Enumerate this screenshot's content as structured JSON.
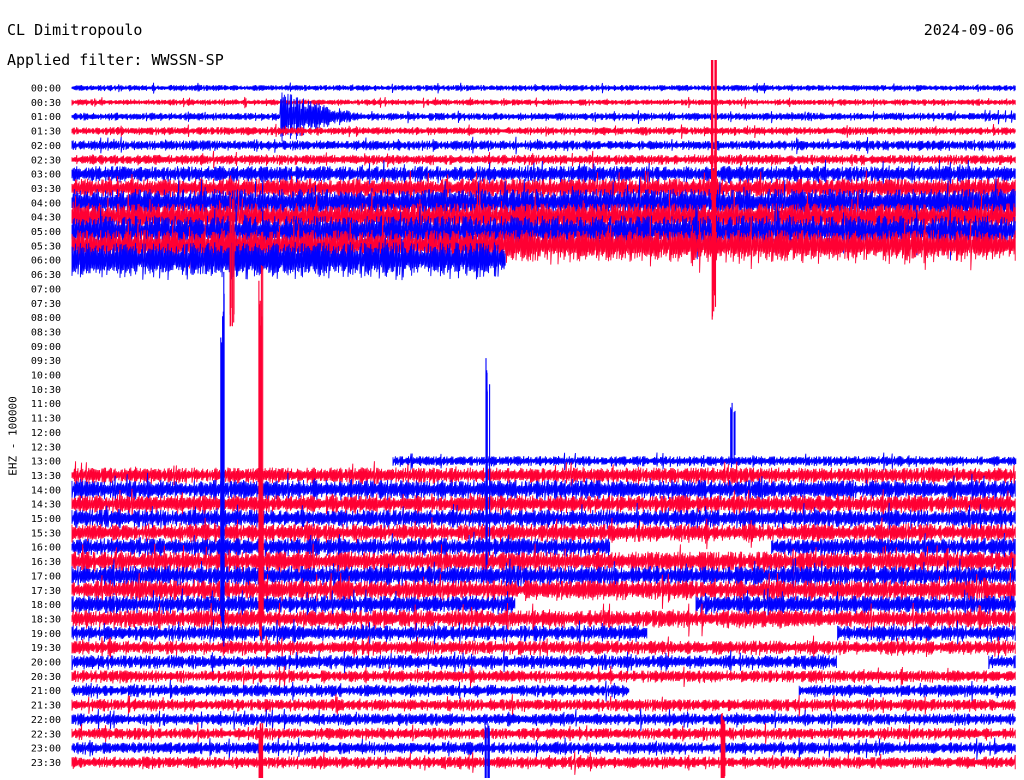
{
  "header": {
    "station": "CL Dimitropoulo",
    "date": "2024-09-06",
    "filter": "Applied filter: WWSSN-SP",
    "channel": "EHZ - 100000"
  },
  "colors": {
    "even_trace": "#0000ff",
    "odd_trace": "#ff0033",
    "background": "#ffffff"
  },
  "chart_data": {
    "type": "line",
    "title": "CL Dimitropoulo",
    "ylabel": "EHZ - 100000",
    "x_range_minutes": [
      0,
      30
    ],
    "row_labels": [
      "00:00",
      "00:30",
      "01:00",
      "01:30",
      "02:00",
      "02:30",
      "03:00",
      "03:30",
      "04:00",
      "04:30",
      "05:00",
      "05:30",
      "06:00",
      "06:30",
      "07:00",
      "07:30",
      "08:00",
      "08:30",
      "09:00",
      "09:30",
      "10:00",
      "10:30",
      "11:00",
      "11:30",
      "12:00",
      "12:30",
      "13:00",
      "13:30",
      "14:00",
      "14:30",
      "15:00",
      "15:30",
      "16:00",
      "16:30",
      "17:00",
      "17:30",
      "18:00",
      "18:30",
      "19:00",
      "19:30",
      "20:00",
      "20:30",
      "21:00",
      "21:30",
      "22:00",
      "22:30",
      "23:00",
      "23:30"
    ],
    "rows": [
      {
        "label": "00:00",
        "noise": 3,
        "start": 0,
        "end": 1
      },
      {
        "label": "00:30",
        "noise": 3,
        "start": 0,
        "end": 1
      },
      {
        "label": "01:00",
        "noise": 4,
        "start": 0,
        "end": 1,
        "bursts": [
          {
            "at": 0.22,
            "width": 0.08,
            "amp": 22
          }
        ]
      },
      {
        "label": "01:30",
        "noise": 4,
        "start": 0,
        "end": 1
      },
      {
        "label": "02:00",
        "noise": 5,
        "start": 0,
        "end": 1
      },
      {
        "label": "02:30",
        "noise": 5,
        "start": 0,
        "end": 1
      },
      {
        "label": "03:00",
        "noise": 8,
        "start": 0,
        "end": 1
      },
      {
        "label": "03:30",
        "noise": 10,
        "start": 0,
        "end": 1
      },
      {
        "label": "04:00",
        "noise": 14,
        "start": 0,
        "end": 1
      },
      {
        "label": "04:30",
        "noise": 14,
        "start": 0,
        "end": 1
      },
      {
        "label": "05:00",
        "noise": 16,
        "start": 0,
        "end": 1
      },
      {
        "label": "05:30",
        "noise": 16,
        "start": 0,
        "end": 1
      },
      {
        "label": "06:00",
        "noise": 18,
        "start": 0,
        "end": 0.46
      },
      {
        "label": "06:30",
        "noise": 0,
        "start": 0,
        "end": 0
      },
      {
        "label": "07:00",
        "noise": 0,
        "start": 0,
        "end": 0
      },
      {
        "label": "07:30",
        "noise": 0,
        "start": 0,
        "end": 0
      },
      {
        "label": "08:00",
        "noise": 0,
        "start": 0,
        "end": 0
      },
      {
        "label": "08:30",
        "noise": 0,
        "start": 0,
        "end": 0
      },
      {
        "label": "09:00",
        "noise": 0,
        "start": 0,
        "end": 0
      },
      {
        "label": "09:30",
        "noise": 0,
        "start": 0,
        "end": 0
      },
      {
        "label": "10:00",
        "noise": 0,
        "start": 0,
        "end": 0
      },
      {
        "label": "10:30",
        "noise": 0,
        "start": 0,
        "end": 0
      },
      {
        "label": "11:00",
        "noise": 0,
        "start": 0,
        "end": 0
      },
      {
        "label": "11:30",
        "noise": 0,
        "start": 0,
        "end": 0
      },
      {
        "label": "12:00",
        "noise": 0,
        "start": 0,
        "end": 0
      },
      {
        "label": "12:30",
        "noise": 0,
        "start": 0,
        "end": 0
      },
      {
        "label": "13:00",
        "noise": 5,
        "start": 0.34,
        "end": 1
      },
      {
        "label": "13:30",
        "noise": 8,
        "start": 0,
        "end": 1
      },
      {
        "label": "14:00",
        "noise": 10,
        "start": 0,
        "end": 1
      },
      {
        "label": "14:30",
        "noise": 9,
        "start": 0,
        "end": 1
      },
      {
        "label": "15:00",
        "noise": 9,
        "start": 0,
        "end": 1
      },
      {
        "label": "15:30",
        "noise": 9,
        "start": 0,
        "end": 1
      },
      {
        "label": "16:00",
        "noise": 9,
        "start": 0,
        "end": 1,
        "gaps": [
          [
            0.57,
            0.74
          ]
        ]
      },
      {
        "label": "16:30",
        "noise": 10,
        "start": 0,
        "end": 1
      },
      {
        "label": "17:00",
        "noise": 10,
        "start": 0,
        "end": 1
      },
      {
        "label": "17:30",
        "noise": 10,
        "start": 0,
        "end": 1
      },
      {
        "label": "18:00",
        "noise": 9,
        "start": 0,
        "end": 1,
        "gaps": [
          [
            0.47,
            0.66
          ]
        ]
      },
      {
        "label": "18:30",
        "noise": 9,
        "start": 0,
        "end": 1
      },
      {
        "label": "19:00",
        "noise": 8,
        "start": 0,
        "end": 1,
        "gaps": [
          [
            0.61,
            0.81
          ]
        ]
      },
      {
        "label": "19:30",
        "noise": 7,
        "start": 0,
        "end": 1
      },
      {
        "label": "20:00",
        "noise": 7,
        "start": 0,
        "end": 1,
        "gaps": [
          [
            0.81,
            0.97
          ]
        ]
      },
      {
        "label": "20:30",
        "noise": 6,
        "start": 0,
        "end": 1
      },
      {
        "label": "21:00",
        "noise": 6,
        "start": 0,
        "end": 1,
        "gaps": [
          [
            0.59,
            0.77
          ]
        ]
      },
      {
        "label": "21:30",
        "noise": 6,
        "start": 0,
        "end": 1
      },
      {
        "label": "22:00",
        "noise": 6,
        "start": 0,
        "end": 1
      },
      {
        "label": "22:30",
        "noise": 6,
        "start": 0,
        "end": 1
      },
      {
        "label": "23:00",
        "noise": 6,
        "start": 0,
        "end": 1
      },
      {
        "label": "23:30",
        "noise": 6,
        "start": 0,
        "end": 1
      }
    ],
    "spikes": [
      {
        "row": "00:00",
        "at": 0.68,
        "amp": 120,
        "color": "odd"
      },
      {
        "row": "05:00",
        "at": 0.68,
        "amp": 90,
        "color": "odd"
      },
      {
        "row": "06:00",
        "at": 0.17,
        "amp": 70,
        "color": "odd"
      },
      {
        "row": "13:00",
        "at": 0.16,
        "amp": 190,
        "color": "even"
      },
      {
        "row": "13:00",
        "at": 0.2,
        "amp": 200,
        "color": "odd"
      },
      {
        "row": "13:00",
        "at": 0.44,
        "amp": 110,
        "color": "even"
      },
      {
        "row": "12:00",
        "at": 0.7,
        "amp": 30,
        "color": "even"
      },
      {
        "row": "16:30",
        "at": 0.2,
        "amp": 60,
        "color": "odd"
      },
      {
        "row": "23:30",
        "at": 0.2,
        "amp": 40,
        "color": "odd"
      },
      {
        "row": "23:30",
        "at": 0.44,
        "amp": 40,
        "color": "even"
      },
      {
        "row": "23:00",
        "at": 0.69,
        "amp": 40,
        "color": "odd"
      }
    ]
  }
}
